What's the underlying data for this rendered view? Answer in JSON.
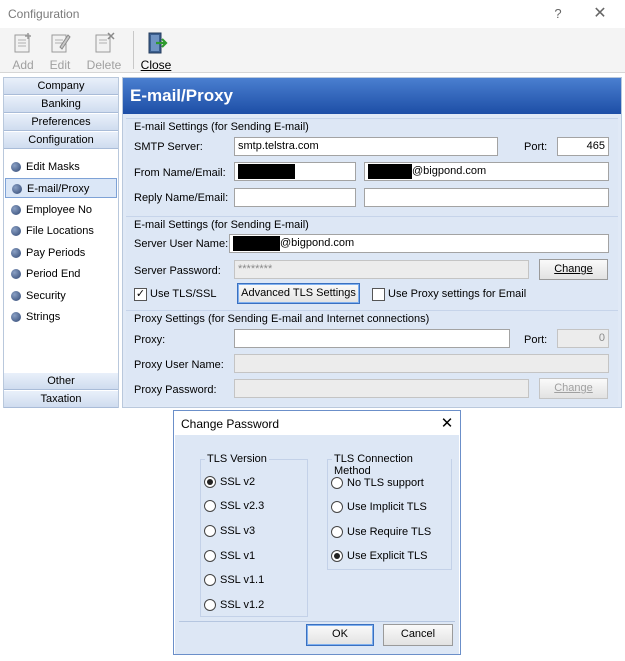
{
  "window": {
    "title": "Configuration",
    "help": "?",
    "close": "✕"
  },
  "toolbar": {
    "add": "Add",
    "edit": "Edit",
    "delete": "Delete",
    "close": "Close"
  },
  "nav": {
    "tabs_top": [
      "Company",
      "Banking",
      "Preferences",
      "Configuration"
    ],
    "items": [
      "Edit Masks",
      "E-mail/Proxy",
      "Employee No",
      "File Locations",
      "Pay Periods",
      "Period End",
      "Security",
      "Strings"
    ],
    "tabs_bottom": [
      "Other",
      "Taxation"
    ]
  },
  "content": {
    "header": "E-mail/Proxy",
    "smtp_group": {
      "title": "E-mail Settings (for Sending E-mail)",
      "smtp_label": "SMTP Server:",
      "smtp_value": "smtp.telstra.com",
      "port_label": "Port:",
      "port_value": "465",
      "from_label": "From Name/Email:",
      "from_email_suffix": "@bigpond.com",
      "reply_label": "Reply Name/Email:"
    },
    "server_group": {
      "title": "E-mail Settings (for Sending E-mail)",
      "user_label": "Server User Name:",
      "user_suffix": "@bigpond.com",
      "password_label": "Server Password:",
      "password_value": "********",
      "change_button": "Change",
      "tls_checkbox": "Use TLS/SSL",
      "tls_checked": true,
      "advanced_button": "Advanced TLS Settings",
      "proxy_checkbox": "Use Proxy settings for Email",
      "proxy_checked": false
    },
    "proxy_group": {
      "title": "Proxy Settings (for Sending E-mail and Internet connections)",
      "proxy_label": "Proxy:",
      "port_label": "Port:",
      "port_value": "0",
      "user_label": "Proxy User Name:",
      "password_label": "Proxy Password:",
      "change_button": "Change"
    }
  },
  "dialog": {
    "title": "Change Password",
    "close": "✕",
    "tls_version": {
      "title": "TLS Version",
      "options": [
        "SSL v2",
        "SSL v2.3",
        "SSL v3",
        "SSL v1",
        "SSL v1.1",
        "SSL v1.2"
      ],
      "selected": "SSL v2"
    },
    "tls_method": {
      "title": "TLS Connection Method",
      "options": [
        "No TLS support",
        "Use Implicit TLS",
        "Use Require TLS",
        "Use Explicit TLS"
      ],
      "selected": "Use Explicit TLS"
    },
    "ok_button": "OK",
    "cancel_button": "Cancel"
  }
}
